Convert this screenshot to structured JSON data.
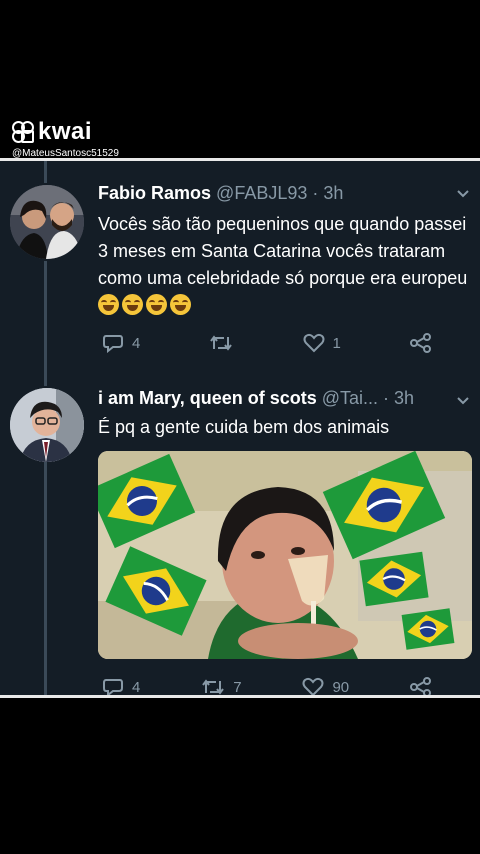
{
  "watermark": {
    "app_name": "kwai",
    "handle": "@MateusSantosc51529"
  },
  "tweets": [
    {
      "name": "Fabio Ramos",
      "handle_time": "@FABJL93 · 3h",
      "text": "Vocês são tão pequeninos que quando passei 3 meses em Santa Catarina vocês trataram como uma celebridade só porque era europeu",
      "emoji": [
        "face-with-tears-of-joy",
        "face-with-tears-of-joy",
        "face-with-tears-of-joy",
        "face-with-tears-of-joy"
      ],
      "replies": "4",
      "retweets": "",
      "likes": "1"
    },
    {
      "name": "i am Mary, queen of scots",
      "handle_time": "@Tai... · 3h",
      "text": "É pq a gente cuida bem dos animais",
      "replies": "4",
      "retweets": "7",
      "likes": "90",
      "media": {
        "description_icons": [
          "brazil-flag"
        ],
        "flag_colors": {
          "green": "#1e9a3a",
          "yellow": "#f2d31b",
          "blue": "#1f3b8c"
        }
      }
    }
  ]
}
